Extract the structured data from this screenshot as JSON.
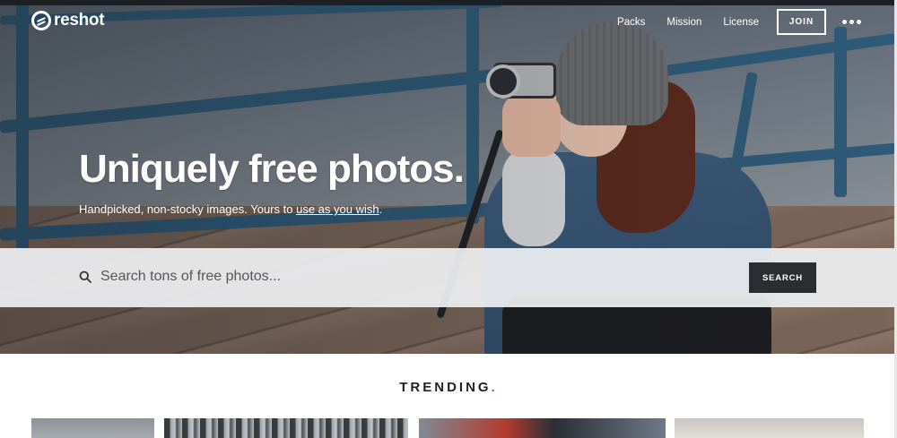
{
  "brand": {
    "name": "reshot"
  },
  "nav": {
    "links": [
      "Packs",
      "Mission",
      "License"
    ],
    "join_label": "JOIN"
  },
  "hero": {
    "headline": "Uniquely free photos.",
    "subline_prefix": "Handpicked, non-stocky images. Yours to ",
    "subline_link": "use as you wish",
    "subline_suffix": "."
  },
  "search": {
    "placeholder": "Search tons of free photos...",
    "button_label": "SEARCH"
  },
  "trending": {
    "title": "TRENDING",
    "accent_dot": ".",
    "accent_color": "#e2423a"
  },
  "icons": {
    "search": "search-icon",
    "more": "more-dots-icon",
    "logo": "reshot-logo-icon"
  }
}
